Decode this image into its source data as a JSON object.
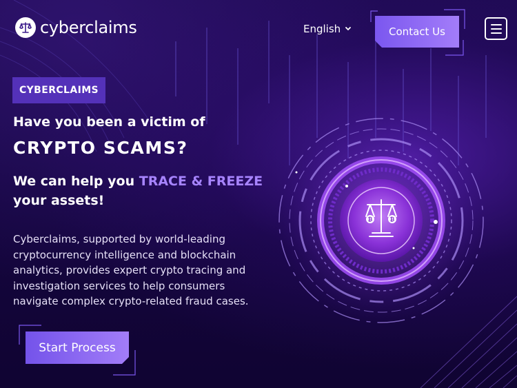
{
  "header": {
    "brand": "cyberclaims",
    "language": "English",
    "contact_label": "Contact Us",
    "icons": {
      "logo": "scales-of-justice-icon",
      "language_caret": "chevron-down-icon",
      "menu": "hamburger-menu-icon"
    }
  },
  "hero": {
    "badge": "CYBERCLAIMS",
    "question": "Have you been a victim of",
    "headline": "CRYPTO SCAMS?",
    "help_prefix": "We can help you ",
    "help_highlight": "TRACE & FREEZE",
    "help_suffix": " your assets!",
    "description": "Cyberclaims, supported by world-leading cryptocurrency intelligence and blockchain analytics, provides expert crypto tracing and investigation services to help consumers navigate complex crypto-related fraud cases.",
    "cta_label": "Start Process",
    "illustration_icon": "crypto-scales-icon"
  },
  "colors": {
    "background": "#14063a",
    "accent": "#7b57ef",
    "accent_light": "#a784ff",
    "badge": "#5431b9"
  }
}
